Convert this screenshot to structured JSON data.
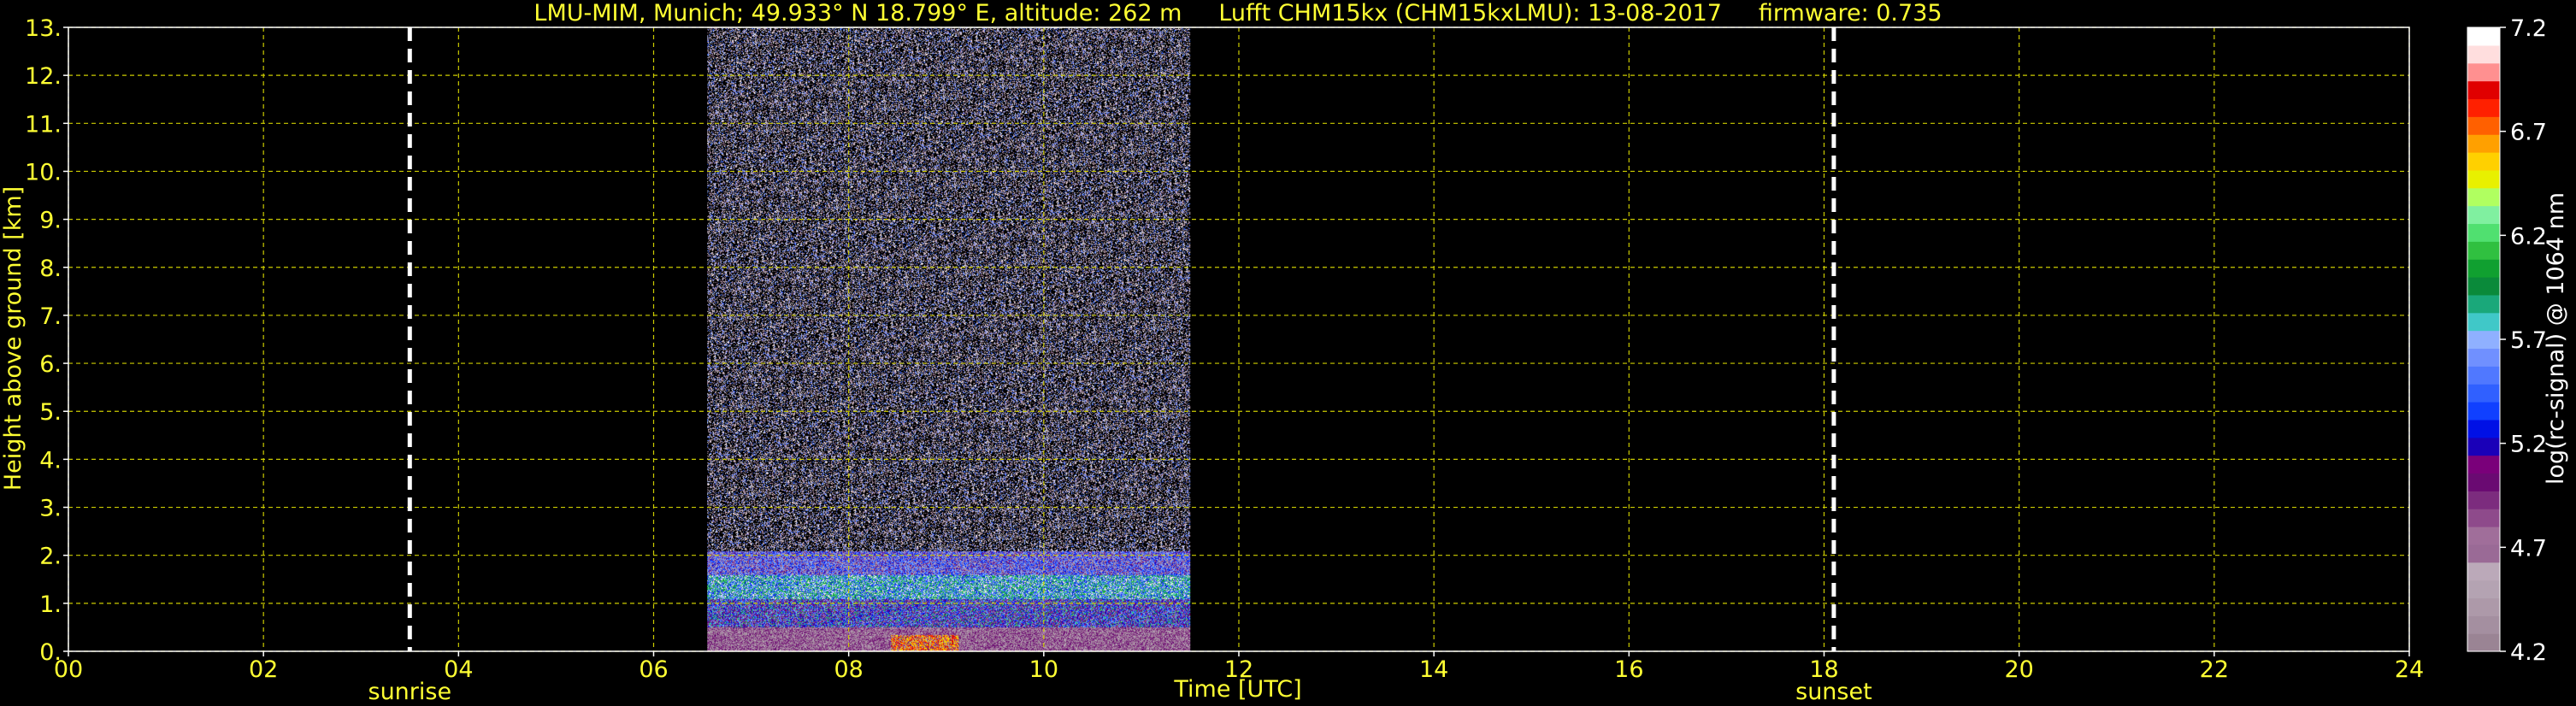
{
  "chart_data": {
    "type": "heatmap",
    "title": "LMU-MIM, Munich; 49.933° N 18.799° E, altitude: 262 m     Lufft CHM15kx (CHM15kxLMU): 13-08-2017     firmware: 0.735",
    "xlabel": "Time [UTC]",
    "ylabel": "Height above ground [km]",
    "xlim": [
      0,
      24
    ],
    "ylim": [
      0,
      13
    ],
    "xticks": [
      "00",
      "02",
      "04",
      "06",
      "08",
      "10",
      "12",
      "14",
      "16",
      "18",
      "20",
      "22",
      "24"
    ],
    "yticks": [
      "0.",
      "1.",
      "2.",
      "3.",
      "4.",
      "5.",
      "6.",
      "7.",
      "8.",
      "9.",
      "10.",
      "11.",
      "12.",
      "13."
    ],
    "grid": true,
    "data_window_hours": [
      6.55,
      11.5
    ],
    "events": [
      {
        "label": "sunrise",
        "time": 3.5
      },
      {
        "label": "sunset",
        "time": 18.1
      }
    ],
    "colorbar": {
      "label": "log(rc-signal) @ 1064 nm",
      "min": 4.2,
      "max": 7.2,
      "ticks": [
        "4.2",
        "4.7",
        "5.2",
        "5.7",
        "6.2",
        "6.7",
        "7.2"
      ],
      "colors": [
        "#9a8494",
        "#a48fa0",
        "#ad99a9",
        "#b4a3b2",
        "#bba9b9",
        "#9a6a96",
        "#a06e9a",
        "#8e4a8b",
        "#7c2c7e",
        "#6a0a72",
        "#7a007a",
        "#1a00b8",
        "#0010e6",
        "#1040ff",
        "#3060ff",
        "#5078ff",
        "#7090ff",
        "#8fb0ff",
        "#40c8c8",
        "#1aa87a",
        "#0a8a3a",
        "#10a030",
        "#30c040",
        "#50e070",
        "#80f0a0",
        "#b0ff60",
        "#e8f000",
        "#ffd000",
        "#ffa000",
        "#ff6000",
        "#ff2000",
        "#e00000",
        "#ff9090",
        "#ffdede",
        "#ffffff"
      ]
    }
  }
}
